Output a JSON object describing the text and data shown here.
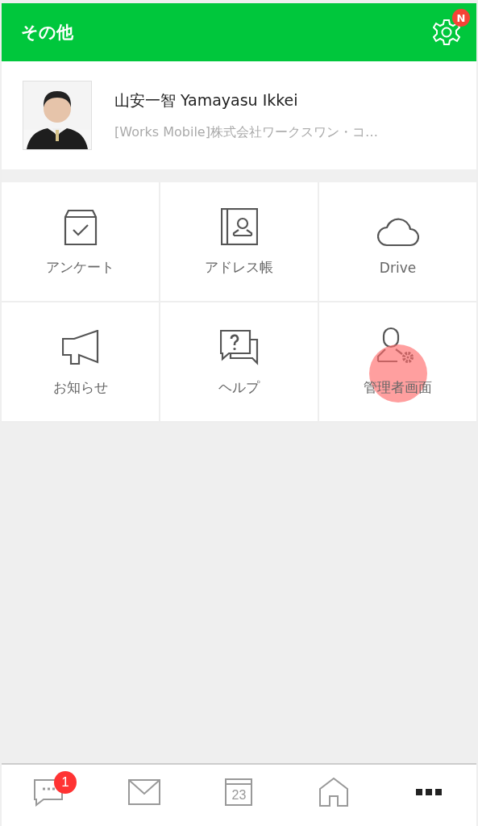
{
  "header": {
    "title": "その他",
    "settings_badge": "N"
  },
  "profile": {
    "name": "山安一智 Yamayasu Ikkei",
    "company": "[Works Mobile]株式会社ワークスワン・コ…"
  },
  "menu": [
    {
      "kind": "survey",
      "label": "アンケート",
      "touched": false
    },
    {
      "kind": "addressbook",
      "label": "アドレス帳",
      "touched": false
    },
    {
      "kind": "drive",
      "label": "Drive",
      "touched": false
    },
    {
      "kind": "notice",
      "label": "お知らせ",
      "touched": false
    },
    {
      "kind": "help",
      "label": "ヘルプ",
      "touched": false
    },
    {
      "kind": "admin",
      "label": "管理者画面",
      "touched": true
    }
  ],
  "tab_bar": [
    {
      "kind": "chat",
      "badge": "1",
      "selected": false
    },
    {
      "kind": "mail",
      "selected": false
    },
    {
      "kind": "calendar",
      "day": "23",
      "selected": false
    },
    {
      "kind": "home",
      "selected": false
    },
    {
      "kind": "more",
      "selected": true
    }
  ]
}
